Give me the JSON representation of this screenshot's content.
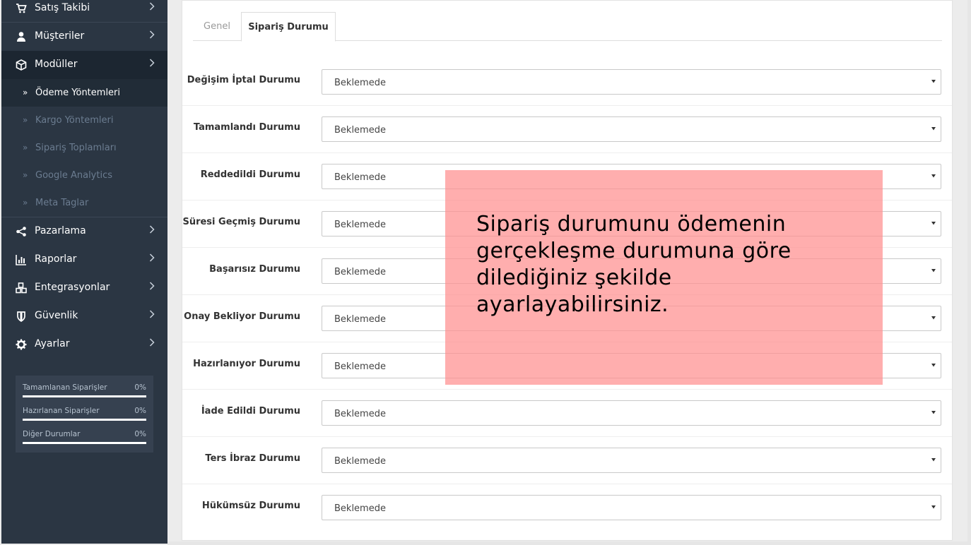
{
  "sidebar": {
    "items_top": [
      {
        "label": "Satış Takibi",
        "icon": "cart-icon"
      },
      {
        "label": "Müşteriler",
        "icon": "user-icon"
      },
      {
        "label": "Modüller",
        "icon": "cube-icon"
      }
    ],
    "submenu": [
      {
        "label": "Ödeme Yöntemleri",
        "active": true
      },
      {
        "label": "Kargo Yöntemleri"
      },
      {
        "label": "Sipariş Toplamları"
      },
      {
        "label": "Google Analytics"
      },
      {
        "label": "Meta Taglar"
      }
    ],
    "items_bottom": [
      {
        "label": "Pazarlama",
        "icon": "share-icon"
      },
      {
        "label": "Raporlar",
        "icon": "bar-chart-icon"
      },
      {
        "label": "Entegrasyonlar",
        "icon": "cubes-icon"
      },
      {
        "label": "Güvenlik",
        "icon": "shield-icon"
      },
      {
        "label": "Ayarlar",
        "icon": "gear-icon"
      }
    ],
    "stats": [
      {
        "label": "Tamamlanan Siparişler",
        "percent": "0%"
      },
      {
        "label": "Hazırlanan Siparişler",
        "percent": "0%"
      },
      {
        "label": "Diğer Durumlar",
        "percent": "0%"
      }
    ]
  },
  "tabs": [
    {
      "label": "Genel"
    },
    {
      "label": "Sipariş Durumu",
      "active": true
    }
  ],
  "form": {
    "rows": [
      {
        "label": "Değişim İptal Durumu",
        "value": "Beklemede"
      },
      {
        "label": "Tamamlandı Durumu",
        "value": "Beklemede"
      },
      {
        "label": "Reddedildi Durumu",
        "value": "Beklemede"
      },
      {
        "label": "Süresi Geçmiş Durumu",
        "value": "Beklemede"
      },
      {
        "label": "Başarısız Durumu",
        "value": "Beklemede"
      },
      {
        "label": "Onay Bekliyor Durumu",
        "value": "Beklemede"
      },
      {
        "label": "Hazırlanıyor Durumu",
        "value": "Beklemede"
      },
      {
        "label": "İade Edildi Durumu",
        "value": "Beklemede"
      },
      {
        "label": "Ters İbraz Durumu",
        "value": "Beklemede"
      },
      {
        "label": "Hükümsüz Durumu",
        "value": "Beklemede"
      }
    ]
  },
  "overlay": {
    "text": "Sipariş durumunu ödemenin gerçekleşme durumuna göre dilediğiniz şekilde ayarlayabilirsiniz.",
    "color": "#ff8f8f"
  },
  "colors": {
    "sidebar_bg": "#2b3643",
    "sidebar_active_bg": "#1c2631",
    "sub_text": "#6b7c90"
  }
}
